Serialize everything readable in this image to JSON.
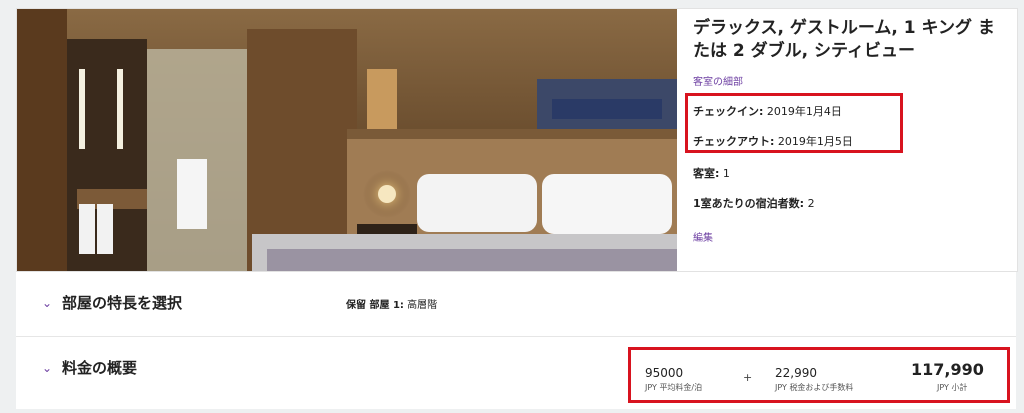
{
  "room": {
    "title": "デラックス, ゲストルーム, 1 キング または 2 ダブル, シティビュー",
    "details_link": "客室の細部",
    "checkin_label": "チェックイン:",
    "checkin_value": "2019年1月4日",
    "checkout_label": "チェックアウト:",
    "checkout_value": "2019年1月5日",
    "rooms_label": "客室:",
    "rooms_value": "1",
    "guests_label": "1室あたりの宿泊者数:",
    "guests_value": "2",
    "edit_link": "編集"
  },
  "features": {
    "title": "部屋の特長を選択",
    "reserve_label": "保留 部屋 1:",
    "reserve_value": "高層階"
  },
  "summary": {
    "title": "料金の概要",
    "avg_rate_value": "95000",
    "avg_rate_label": "JPY 平均料金/泊",
    "plus": "+",
    "tax_value": "22,990",
    "tax_label": "JPY 税金および手数料",
    "subtotal_value": "117,990",
    "subtotal_label": "JPY 小計"
  },
  "colors": {
    "accent": "#6d3fa2",
    "highlight": "#d8131f"
  },
  "icons": {
    "chevron": "chevron-down-icon"
  }
}
